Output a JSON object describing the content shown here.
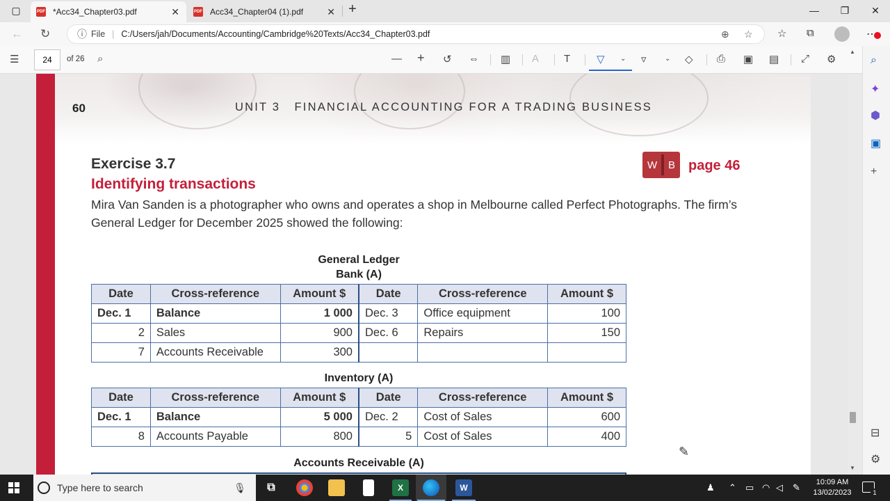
{
  "browser": {
    "tabs": [
      {
        "label": "*Acc34_Chapter03.pdf",
        "active": true
      },
      {
        "label": "Acc34_Chapter04 (1).pdf",
        "active": false
      }
    ],
    "address": {
      "scheme_label": "File",
      "url": "C:/Users/jah/Documents/Accounting/Cambridge%20Texts/Acc34_Chapter03.pdf"
    }
  },
  "pdf_toolbar": {
    "page_current": "24",
    "page_total_label": "of 26"
  },
  "document": {
    "page_number": "60",
    "unit_heading": "UNIT 3   FINANCIAL ACCOUNTING FOR A TRADING BUSINESS",
    "exercise_title": "Exercise 3.7",
    "exercise_subtitle": "Identifying transactions",
    "workbook_badge_w": "W",
    "workbook_badge_b": "B",
    "workbook_ref": "page 46",
    "intro_text": "Mira Van Sanden is a photographer who owns and operates a shop in Melbourne called Perfect Photographs. The firm’s General Ledger for December 2025 showed the following:",
    "ledger_heading": "General Ledger",
    "ledger_headers": [
      "Date",
      "Cross-reference",
      "Amount $",
      "Date",
      "Cross-reference",
      "Amount $"
    ],
    "bank": {
      "title": "Bank (A)",
      "rows": [
        [
          "Dec. 1",
          "Balance",
          "1 000",
          "Dec. 3",
          "Office equipment",
          "100"
        ],
        [
          "2",
          "Sales",
          "900",
          "Dec. 6",
          "Repairs",
          "150"
        ],
        [
          "7",
          "Accounts Receivable",
          "300",
          "",
          "",
          ""
        ]
      ]
    },
    "inventory": {
      "title": "Inventory (A)",
      "rows": [
        [
          "Dec. 1",
          "Balance",
          "5 000",
          "Dec. 2",
          "Cost of Sales",
          "600"
        ],
        [
          "8",
          "Accounts Payable",
          "800",
          "5",
          "Cost of Sales",
          "400"
        ]
      ]
    },
    "accounts_receivable": {
      "title": "Accounts Receivable (A)"
    }
  },
  "taskbar": {
    "search_placeholder": "Type here to search",
    "time": "10:09 AM",
    "date": "13/02/2023",
    "notification_count": "1"
  },
  "colors": {
    "accent_red": "#c41f3a",
    "table_header_bg": "#dfe3ef",
    "table_border": "#2d4f86"
  }
}
